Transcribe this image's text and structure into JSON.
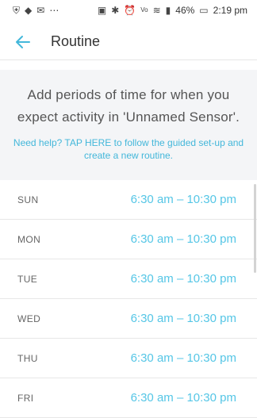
{
  "status_bar": {
    "battery": "46%",
    "time": "2:19 pm",
    "icons_left": [
      "shield-icon",
      "game-icon",
      "mail-icon",
      "more-icon"
    ],
    "icons_right": [
      "nfc-icon",
      "bluetooth-icon",
      "alarm-icon",
      "volte-icon",
      "wifi-icon",
      "signal-icon",
      "battery-icon"
    ]
  },
  "app_bar": {
    "title": "Routine"
  },
  "intro": {
    "text": "Add periods of time for when you expect activity in 'Unnamed Sensor'.",
    "help": "Need help? TAP HERE to follow the guided set-up and create a new routine."
  },
  "schedule": [
    {
      "day": "SUN",
      "time": "6:30 am – 10:30 pm"
    },
    {
      "day": "MON",
      "time": "6:30 am – 10:30 pm"
    },
    {
      "day": "TUE",
      "time": "6:30 am – 10:30 pm"
    },
    {
      "day": "WED",
      "time": "6:30 am – 10:30 pm"
    },
    {
      "day": "THU",
      "time": "6:30 am – 10:30 pm"
    },
    {
      "day": "FRI",
      "time": "6:30 am – 10:30 pm"
    }
  ],
  "colors": {
    "accent": "#43b7da",
    "intro_bg": "#f4f5f7"
  }
}
